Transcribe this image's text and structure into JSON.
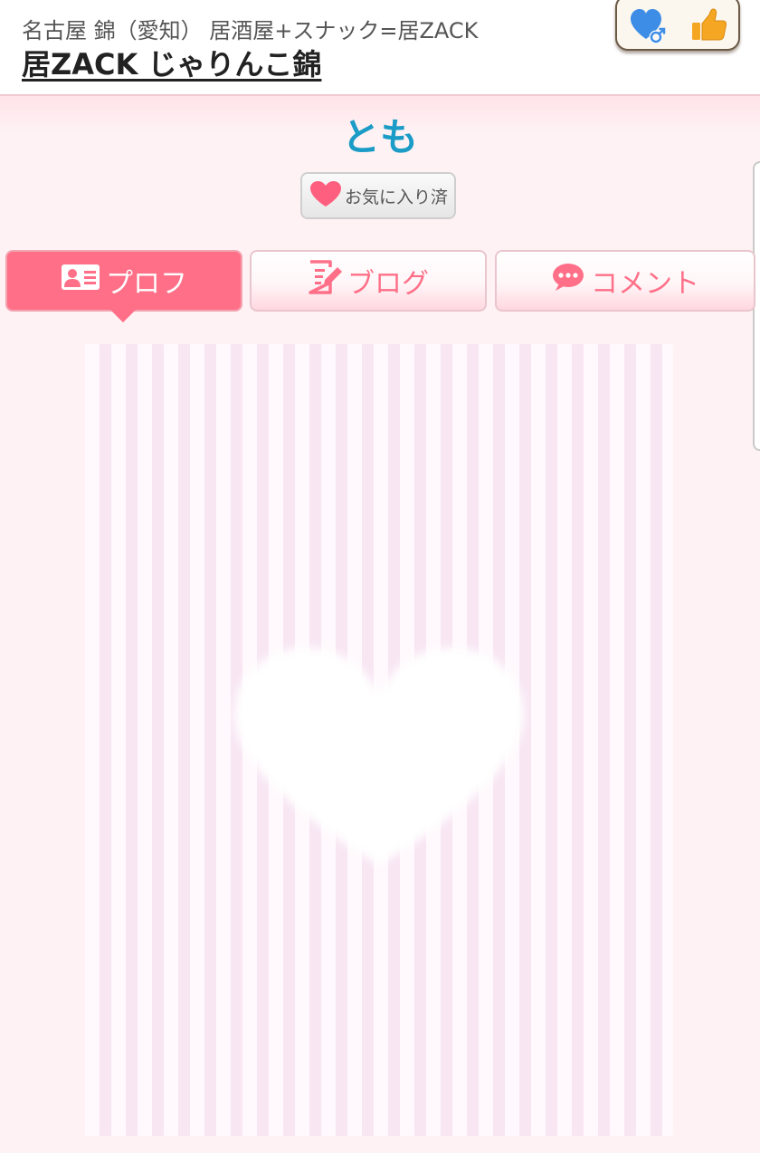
{
  "header": {
    "subtitle": "名古屋 錦（愛知） 居酒屋+スナック=居ZACK",
    "shop_name": "居ZACK じゃりんこ錦",
    "actions": [
      {
        "icon": "heart-male-icon"
      },
      {
        "icon": "thumbs-up-icon"
      }
    ]
  },
  "cast": {
    "name": "とも",
    "favorite_label": "お気に入り済"
  },
  "tabs": [
    {
      "label": "プロフ",
      "icon": "profile-card-icon",
      "active": true
    },
    {
      "label": "ブログ",
      "icon": "blog-edit-icon",
      "active": false
    },
    {
      "label": "コメント",
      "icon": "comment-bubble-icon",
      "active": false
    }
  ],
  "colors": {
    "accent_pink": "#ff7088",
    "name_blue": "#1b9cc7",
    "favorite_heart": "#ff5f7e",
    "like_orange": "#f5a623",
    "heart_blue": "#3d8de6"
  }
}
